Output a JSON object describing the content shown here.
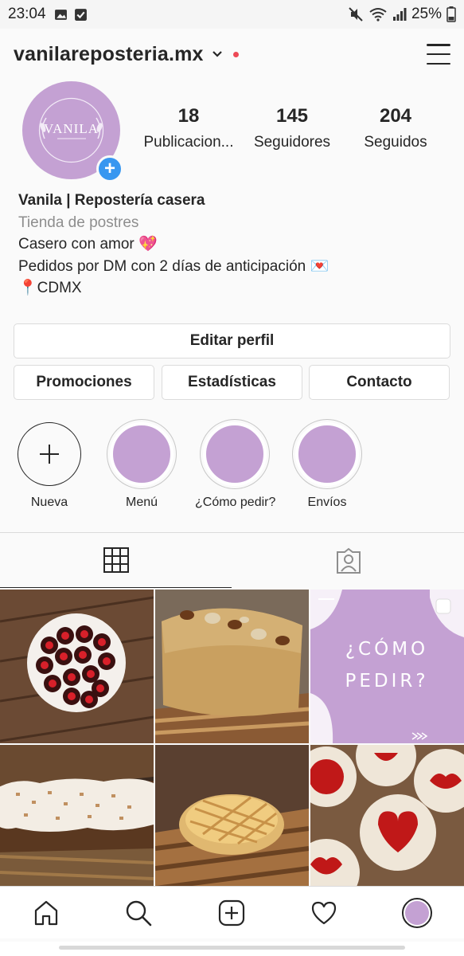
{
  "status_bar": {
    "time": "23:04",
    "battery": "25%"
  },
  "header": {
    "username": "vanilareposteria.mx"
  },
  "profile": {
    "avatar_text": "VANILA",
    "stats": [
      {
        "value": "18",
        "label": "Publicacion..."
      },
      {
        "value": "145",
        "label": "Seguidores"
      },
      {
        "value": "204",
        "label": "Seguidos"
      }
    ],
    "bio": {
      "name": "Vanila | Repostería casera",
      "category": "Tienda de postres",
      "line1": "Casero con amor 💖",
      "line2": "Pedidos por DM con 2 días de anticipación 💌",
      "line3": "📍CDMX"
    }
  },
  "buttons": {
    "edit_profile": "Editar perfil",
    "promotions": "Promociones",
    "stats": "Estadísticas",
    "contact": "Contacto"
  },
  "highlights": [
    {
      "label": "Nueva"
    },
    {
      "label": "Menú"
    },
    {
      "label": "¿Cómo pedir?"
    },
    {
      "label": "Envíos"
    }
  ],
  "posts": [
    {
      "kind": "photo",
      "subject": "chocolate-heart-cookies"
    },
    {
      "kind": "photo",
      "subject": "banana-bread"
    },
    {
      "kind": "graphic",
      "line1": "¿CÓMO",
      "line2": "PEDIR?"
    },
    {
      "kind": "photo",
      "subject": "frosted-loaf-cake"
    },
    {
      "kind": "photo",
      "subject": "lattice-pie"
    },
    {
      "kind": "photo",
      "subject": "linzer-heart-cookies"
    }
  ],
  "colors": {
    "brand_lilac": "#c4a1d3",
    "blue": "#3897f0",
    "notification_red": "#ed4956"
  },
  "icons": {
    "status": [
      "photo-icon",
      "download-icon",
      "mute-icon",
      "wifi-icon",
      "signal-icon",
      "battery-icon"
    ],
    "tabs": [
      "grid-icon",
      "tagged-icon"
    ],
    "nav": [
      "home-icon",
      "search-icon",
      "add-post-icon",
      "heart-icon",
      "profile-avatar"
    ]
  }
}
